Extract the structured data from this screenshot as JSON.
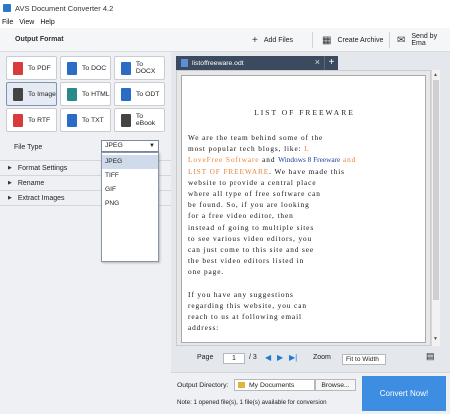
{
  "app": {
    "title": "AVS Document Converter 4.2"
  },
  "menu": [
    "File",
    "View",
    "Help"
  ],
  "toolbar": {
    "output_format": "Output Format",
    "add_files": "Add Files",
    "create_archive": "Create Archive",
    "send_by_email": "Send by Ema"
  },
  "formats": [
    {
      "label": "To PDF",
      "color": "#d83b3b"
    },
    {
      "label": "To DOC",
      "color": "#2b6cc4"
    },
    {
      "label": "To DOCX",
      "color": "#2b6cc4"
    },
    {
      "label": "To Image",
      "color": "#444444"
    },
    {
      "label": "To HTML",
      "color": "#2a8a8a"
    },
    {
      "label": "To ODT",
      "color": "#2b6cc4"
    },
    {
      "label": "To RTF",
      "color": "#d83b3b"
    },
    {
      "label": "To TXT",
      "color": "#2b6cc4"
    },
    {
      "label": "To eBook",
      "color": "#444444"
    }
  ],
  "file_type": {
    "label": "File Type",
    "value": "JPEG",
    "options": [
      "JPEG",
      "TIFF",
      "GIF",
      "PNG"
    ]
  },
  "sections": [
    "Format Settings",
    "Rename",
    "Extract Images"
  ],
  "document": {
    "tab_name": "listoffreeware.odt",
    "title": "LIST OF FREEWARE",
    "lines": [
      [
        {
          "t": "We are the team behind some of the"
        }
      ],
      [
        {
          "t": "most popular tech blogs, like: "
        },
        {
          "t": "L",
          "c": "or"
        }
      ],
      [
        {
          "t": "LoveFree Software",
          "c": "or"
        },
        {
          "t": " and "
        },
        {
          "t": "Windows 8 Freeware",
          "c": "bl"
        },
        {
          "t": " and",
          "c": "or"
        }
      ],
      [
        {
          "t": "LIST OF FREEWARE",
          "c": "or"
        },
        {
          "t": ". We have made this"
        }
      ],
      [
        {
          "t": "website to provide a central place"
        }
      ],
      [
        {
          "t": "where all type of free software can"
        }
      ],
      [
        {
          "t": "be found. So, if you are looking"
        }
      ],
      [
        {
          "t": "for a free video editor, then"
        }
      ],
      [
        {
          "t": "instead of going to multiple sites"
        }
      ],
      [
        {
          "t": "to see various video editors, you"
        }
      ],
      [
        {
          "t": "can just come to this site and see"
        }
      ],
      [
        {
          "t": "the best video editors listed in"
        }
      ],
      [
        {
          "t": "one page."
        }
      ],
      [
        {
          "t": ""
        }
      ],
      [
        {
          "t": "If you have any suggestions"
        }
      ],
      [
        {
          "t": "regarding this website, you can"
        }
      ],
      [
        {
          "t": "reach to us at following email"
        }
      ],
      [
        {
          "t": "address:"
        }
      ]
    ]
  },
  "nav": {
    "page_label": "Page",
    "page_num": "1",
    "page_total": "/ 3",
    "zoom_label": "Zoom",
    "zoom_value": "Fit to Width"
  },
  "output": {
    "label": "Output Directory:",
    "dir": "My Documents",
    "browse": "Browse...",
    "note": "Note: 1 opened file(s), 1 file(s) available for conversion",
    "convert": "Convert Now!"
  }
}
